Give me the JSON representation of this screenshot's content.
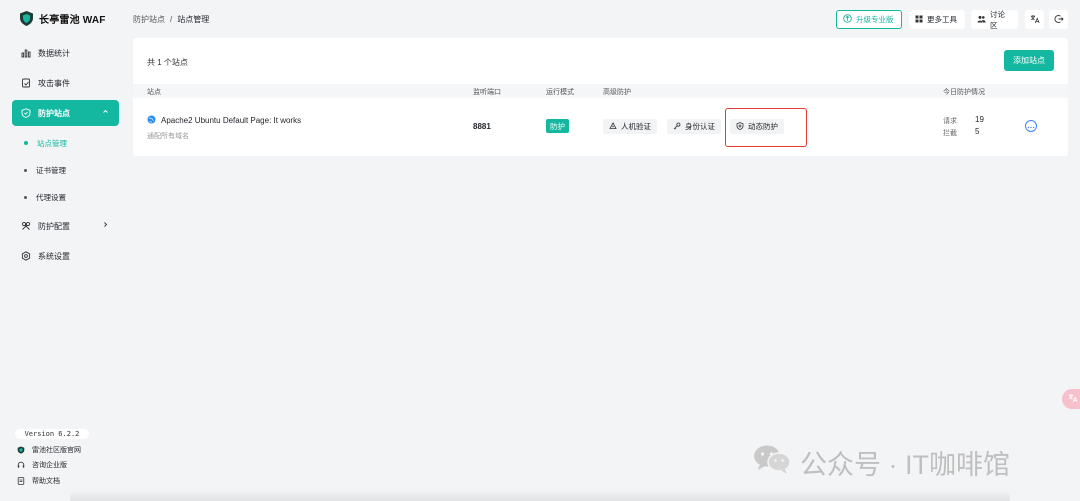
{
  "app": {
    "title": "长亭雷池 WAF"
  },
  "sidebar": {
    "items": [
      {
        "label": "数据统计",
        "icon": "bar-chart-icon"
      },
      {
        "label": "攻击事件",
        "icon": "document-check-icon"
      },
      {
        "label": "防护站点",
        "icon": "shield-icon",
        "active": true
      },
      {
        "label": "防护配置",
        "icon": "tools-icon"
      },
      {
        "label": "系统设置",
        "icon": "gear-icon"
      }
    ],
    "subitems": [
      {
        "label": "站点管理",
        "active": true
      },
      {
        "label": "证书管理"
      },
      {
        "label": "代理设置"
      }
    ],
    "version": "Version 6.2.2",
    "footer": [
      {
        "label": "雷池社区版官网",
        "icon": "shield-small-icon"
      },
      {
        "label": "咨询企业版",
        "icon": "headset-icon"
      },
      {
        "label": "帮助文档",
        "icon": "doc-icon"
      }
    ]
  },
  "header": {
    "breadcrumb": [
      "防护站点",
      "站点管理"
    ],
    "breadcrumb_sep": "/",
    "upgrade_label": "升级专业版",
    "tools_label": "更多工具",
    "forum_label": "讨论区"
  },
  "main": {
    "count_text": "共 1 个站点",
    "add_label": "添加站点",
    "columns": [
      "站点",
      "监听端口",
      "运行模式",
      "高级防护",
      "今日防护情况"
    ],
    "rows": [
      {
        "title": "Apache2 Ubuntu Default Page: It works",
        "subtitle": "通配所有域名",
        "port": "8881",
        "mode": "防护",
        "tags": [
          "人机验证",
          "身份认证",
          "动态防护"
        ],
        "requests_label": "请求",
        "requests": "19",
        "blocked_label": "拦截",
        "blocked": "5"
      }
    ]
  },
  "watermark": {
    "text": "公众号 · IT咖啡馆"
  },
  "colors": {
    "accent": "#14b8a0",
    "highlight": "#e53935"
  }
}
